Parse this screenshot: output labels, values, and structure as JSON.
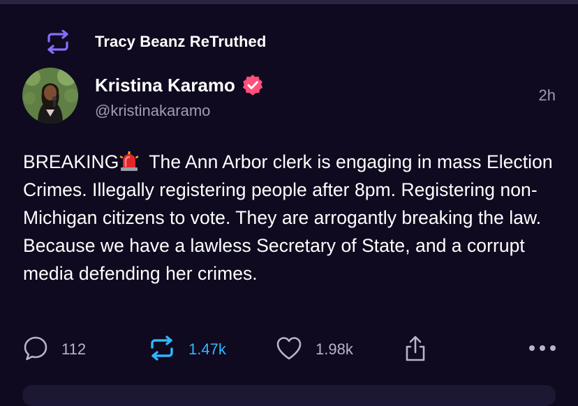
{
  "retruth": {
    "label": "Tracy Beanz ReTruthed",
    "icon": "retruth-icon",
    "color": "#8b6cff"
  },
  "author": {
    "name": "Kristina Karamo",
    "handle": "@kristinakaramo",
    "verified": true,
    "verified_color": "#ff4f7b"
  },
  "post": {
    "timestamp": "2h",
    "text_before_emoji": "BREAKING",
    "emoji": "siren",
    "text_after_emoji": " The Ann Arbor clerk is engaging in mass Election Crimes. Illegally registering people after 8pm. Registering non-Michigan citizens to vote. They are arrogantly breaking the law. Because we have a lawless Secretary of State, and a corrupt media defending her crimes."
  },
  "actions": {
    "replies": "112",
    "retruths": "1.47k",
    "retruths_active_color": "#2fb7ff",
    "likes": "1.98k",
    "share_icon": "share-icon",
    "more_icon": "more-icon"
  }
}
